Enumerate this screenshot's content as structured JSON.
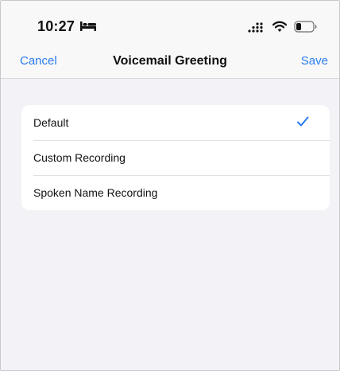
{
  "status_bar": {
    "time": "10:27",
    "icons": [
      "bed-icon",
      "signal-icon",
      "wifi-icon",
      "battery-icon"
    ]
  },
  "nav": {
    "cancel_label": "Cancel",
    "title": "Voicemail Greeting",
    "save_label": "Save"
  },
  "options": [
    {
      "label": "Default",
      "selected": true
    },
    {
      "label": "Custom Recording",
      "selected": false
    },
    {
      "label": "Spoken Name Recording",
      "selected": false
    }
  ],
  "colors": {
    "accent": "#2a7cf0",
    "background": "#f2f2f7",
    "card": "#ffffff"
  }
}
